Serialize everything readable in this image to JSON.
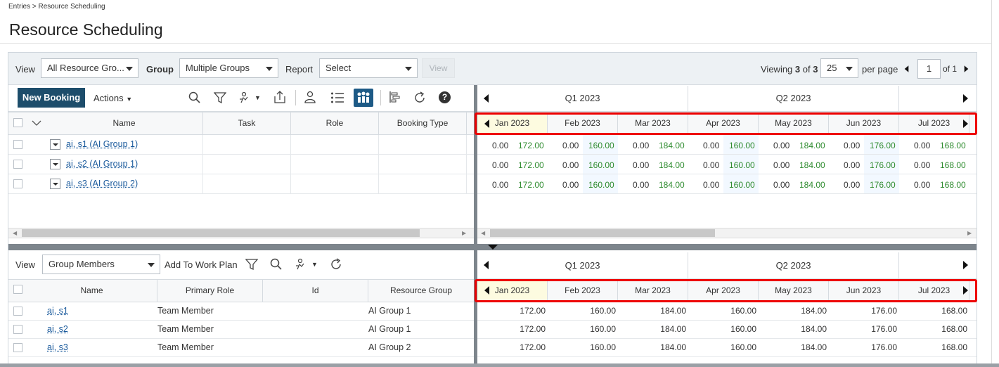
{
  "breadcrumb": "Entries > Resource Scheduling",
  "page_title": "Resource Scheduling",
  "filters": {
    "view_label": "View",
    "view_value": "All Resource Gro...",
    "group_label": "Group",
    "group_value": "Multiple Groups",
    "report_label": "Report",
    "report_value": "Select",
    "view_button": "View",
    "viewing_prefix": "Viewing",
    "viewing_count": "3",
    "viewing_of": "of",
    "viewing_total": "3",
    "per_page_value": "25",
    "per_page_label": "per page",
    "page_value": "1",
    "page_of": "of 1"
  },
  "toolbar": {
    "new_booking": "New Booking",
    "actions": "Actions"
  },
  "top_grid": {
    "columns": [
      "Name",
      "Task",
      "Role",
      "Booking Type"
    ],
    "rows": [
      {
        "name": "ai, s1 (AI Group 1)"
      },
      {
        "name": "ai, s2 (AI Group 1)"
      },
      {
        "name": "ai, s3 (AI Group 2)"
      }
    ]
  },
  "timeline": {
    "quarters": [
      "Q1 2023",
      "Q2 2023"
    ],
    "months": [
      "Jan 2023",
      "Feb 2023",
      "Mar 2023",
      "Apr 2023",
      "May 2023",
      "Jun 2023",
      "Jul 2023"
    ],
    "top_rows": [
      [
        [
          "0.00",
          "172.00"
        ],
        [
          "0.00",
          "160.00"
        ],
        [
          "0.00",
          "184.00"
        ],
        [
          "0.00",
          "160.00"
        ],
        [
          "0.00",
          "184.00"
        ],
        [
          "0.00",
          "176.00"
        ],
        [
          "0.00",
          "168.00"
        ]
      ],
      [
        [
          "0.00",
          "172.00"
        ],
        [
          "0.00",
          "160.00"
        ],
        [
          "0.00",
          "184.00"
        ],
        [
          "0.00",
          "160.00"
        ],
        [
          "0.00",
          "184.00"
        ],
        [
          "0.00",
          "176.00"
        ],
        [
          "0.00",
          "168.00"
        ]
      ],
      [
        [
          "0.00",
          "172.00"
        ],
        [
          "0.00",
          "160.00"
        ],
        [
          "0.00",
          "184.00"
        ],
        [
          "0.00",
          "160.00"
        ],
        [
          "0.00",
          "184.00"
        ],
        [
          "0.00",
          "176.00"
        ],
        [
          "0.00",
          "168.00"
        ]
      ]
    ],
    "bottom_rows": [
      [
        "172.00",
        "160.00",
        "184.00",
        "160.00",
        "184.00",
        "176.00",
        "168.00"
      ],
      [
        "172.00",
        "160.00",
        "184.00",
        "160.00",
        "184.00",
        "176.00",
        "168.00"
      ],
      [
        "172.00",
        "160.00",
        "184.00",
        "160.00",
        "184.00",
        "176.00",
        "168.00"
      ]
    ]
  },
  "bottom": {
    "view_label": "View",
    "view_value": "Group Members",
    "add_to_work_plan": "Add To Work Plan",
    "columns": [
      "Name",
      "Primary Role",
      "Id",
      "Resource Group"
    ],
    "rows": [
      {
        "name": "ai, s1",
        "role": "Team Member",
        "id": "",
        "group": "AI Group 1"
      },
      {
        "name": "ai, s2",
        "role": "Team Member",
        "id": "",
        "group": "AI Group 1"
      },
      {
        "name": "ai, s3",
        "role": "Team Member",
        "id": "",
        "group": "AI Group 2"
      }
    ]
  },
  "colors": {
    "accent": "#1d4d6b",
    "highlight": "#ee0000",
    "positive": "#2e8b2e",
    "link": "#1a5a9c"
  }
}
